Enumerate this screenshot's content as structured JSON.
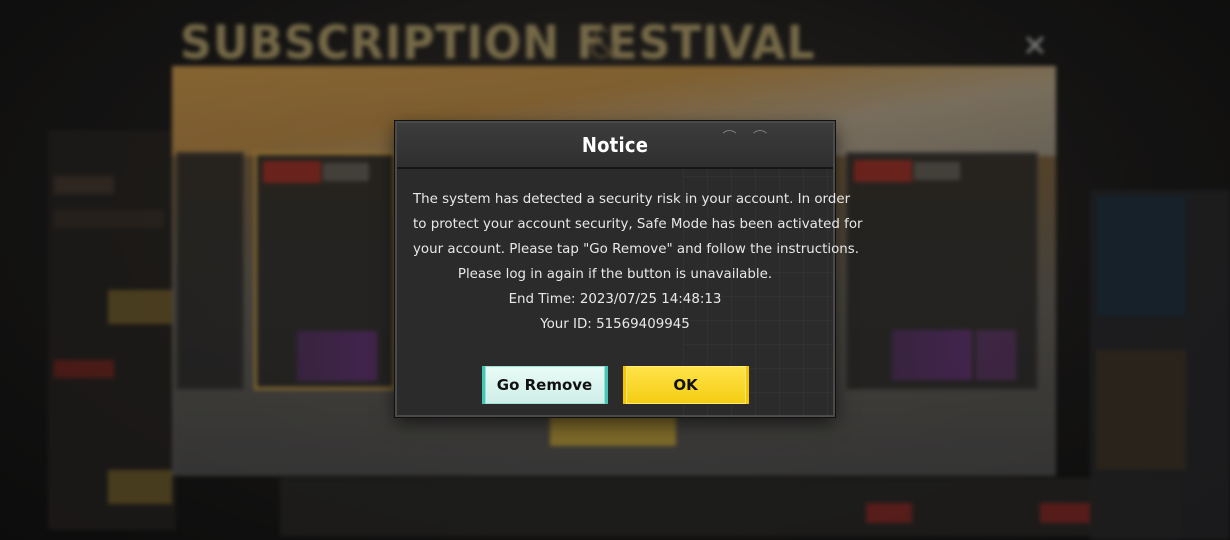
{
  "background": {
    "festival_title": "SUBSCRIPTION FESTIVAL",
    "close_icon": "close-icon"
  },
  "dialog": {
    "title": "Notice",
    "message_lines": [
      "The system has detected a security risk in your account. In order",
      "to protect your account security, Safe Mode has been activated for",
      "your account. Please tap \"Go Remove\" and follow the instructions.",
      "Please log in again if the button is unavailable."
    ],
    "end_time": "End Time: 2023/07/25 14:48:13",
    "your_id": "Your ID: 51569409945",
    "go_remove_label": "Go Remove",
    "ok_label": "OK"
  },
  "colors": {
    "ok_button": "#f4cd12",
    "go_remove_button": "#cfeee7",
    "dialog_bg": "#2b2b2b"
  }
}
